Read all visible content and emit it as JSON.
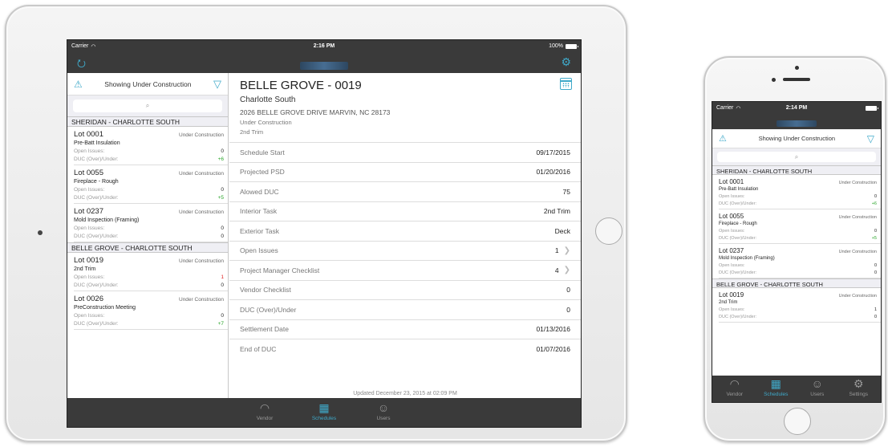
{
  "ipad": {
    "status": {
      "carrier": "Carrier",
      "wifi_icon": "wifi-icon",
      "time": "2:16 PM",
      "battery": "100%"
    },
    "nav": {
      "left_icon": "vendor-switch-icon",
      "right_icon": "gear-icon"
    },
    "filter": {
      "warning_icon": "warning-icon",
      "text": "Showing Under Construction",
      "filter_icon": "filter-icon"
    },
    "search": {
      "placeholder": "🔍"
    },
    "sections": [
      {
        "title": "SHERIDAN - CHARLOTTE SOUTH",
        "lots": [
          {
            "name": "Lot 0001",
            "status": "Under Construction",
            "task": "Pre-Batt Insulation",
            "open_label": "Open Issues:",
            "open_value": "0",
            "duc_label": "DUC (Over)/Under:",
            "duc_value": "+6"
          },
          {
            "name": "Lot 0055",
            "status": "Under Construction",
            "task": "Fireplace - Rough",
            "open_label": "Open Issues:",
            "open_value": "0",
            "duc_label": "DUC (Over)/Under:",
            "duc_value": "+5"
          },
          {
            "name": "Lot 0237",
            "status": "Under Construction",
            "task": "Mold Inspection (Framing)",
            "open_label": "Open Issues:",
            "open_value": "0",
            "duc_label": "DUC (Over)/Under:",
            "duc_value": "0"
          }
        ]
      },
      {
        "title": "BELLE GROVE - CHARLOTTE SOUTH",
        "lots": [
          {
            "name": "Lot 0019",
            "status": "Under Construction",
            "task": "2nd Trim",
            "open_label": "Open Issues:",
            "open_value": "1",
            "duc_label": "DUC (Over)/Under:",
            "duc_value": "0"
          },
          {
            "name": "Lot 0026",
            "status": "Under Construction",
            "task": "PreConstruction Meeting",
            "open_label": "Open Issues:",
            "open_value": "0",
            "duc_label": "DUC (Over)/Under:",
            "duc_value": "+7"
          }
        ]
      }
    ],
    "detail": {
      "title": "BELLE GROVE - 0019",
      "subtitle": "Charlotte South",
      "address": "2026  BELLE GROVE DRIVE MARVIN, NC 28173",
      "status": "Under Construction",
      "task": "2nd Trim",
      "calendar_icon": "calendar-icon",
      "rows": [
        {
          "label": "Schedule Start",
          "value": "09/17/2015",
          "chevron": false
        },
        {
          "label": "Projected PSD",
          "value": "01/20/2016",
          "chevron": false
        },
        {
          "label": "Alowed DUC",
          "value": "75",
          "chevron": false
        },
        {
          "label": "Interior Task",
          "value": "2nd Trim",
          "chevron": false
        },
        {
          "label": "Exterior Task",
          "value": "Deck",
          "chevron": false
        },
        {
          "label": "Open Issues",
          "value": "1",
          "chevron": true
        },
        {
          "label": "Project Manager Checklist",
          "value": "4",
          "chevron": true
        },
        {
          "label": "Vendor Checklist",
          "value": "0",
          "chevron": false
        },
        {
          "label": "DUC (Over)/Under",
          "value": "0",
          "chevron": false
        },
        {
          "label": "Settlement Date",
          "value": "01/13/2016",
          "chevron": false
        },
        {
          "label": "End of DUC",
          "value": "01/07/2016",
          "chevron": false
        }
      ],
      "updated": "Updated December 23, 2015 at 02:09 PM"
    },
    "tabs": [
      {
        "label": "Vendor",
        "icon": "hardhat-icon",
        "active": false
      },
      {
        "label": "Schedules",
        "icon": "calendar-icon",
        "active": true
      },
      {
        "label": "Users",
        "icon": "users-icon",
        "active": false
      }
    ]
  },
  "iphone": {
    "status": {
      "carrier": "Carrier",
      "wifi_icon": "wifi-icon",
      "time": "2:14 PM"
    },
    "filter": {
      "text": "Showing Under Construction"
    },
    "sections": [
      {
        "title": "SHERIDAN - CHARLOTTE SOUTH",
        "lots": [
          {
            "name": "Lot 0001",
            "status": "Under Construction",
            "task": "Pre-Batt Insulation",
            "open_label": "Open Issues:",
            "open_value": "0",
            "duc_label": "DUC (Over)/Under:",
            "duc_value": "+6"
          },
          {
            "name": "Lot 0055",
            "status": "Under Construction",
            "task": "Fireplace - Rough",
            "open_label": "Open Issues:",
            "open_value": "0",
            "duc_label": "DUC (Over)/Under:",
            "duc_value": "+5"
          },
          {
            "name": "Lot 0237",
            "status": "Under Construction",
            "task": "Mold Inspection (Framing)",
            "open_label": "Open Issues:",
            "open_value": "0",
            "duc_label": "DUC (Over)/Under:",
            "duc_value": "0"
          }
        ]
      },
      {
        "title": "BELLE GROVE - CHARLOTTE SOUTH",
        "lots": [
          {
            "name": "Lot 0019",
            "status": "Under Construction",
            "task": "2nd Trim",
            "open_label": "Open Issues:",
            "open_value": "1",
            "duc_label": "DUC (Over)/Under:",
            "duc_value": "0"
          }
        ]
      }
    ],
    "tabs": [
      {
        "label": "Vendor",
        "icon": "hardhat-icon",
        "active": false
      },
      {
        "label": "Schedules",
        "icon": "calendar-icon",
        "active": true
      },
      {
        "label": "Users",
        "icon": "users-icon",
        "active": false
      },
      {
        "label": "Settings",
        "icon": "gear-icon",
        "active": false
      }
    ]
  },
  "colors": {
    "accent": "#3fa9c9",
    "bar": "#3a3a3a",
    "positive": "#2aa52a",
    "negative": "#e02020"
  }
}
